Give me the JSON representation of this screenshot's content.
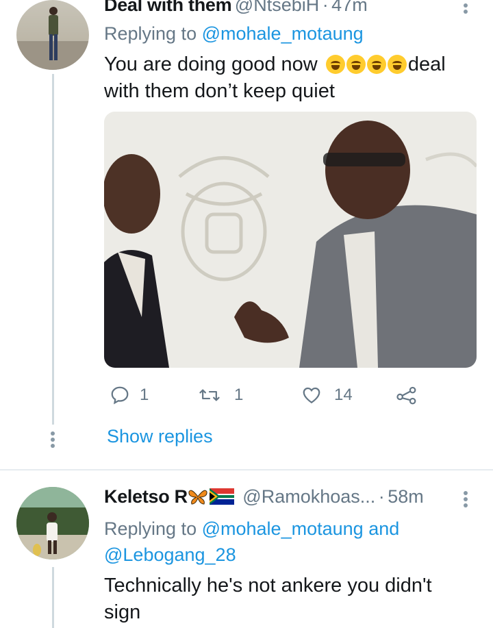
{
  "tweet1": {
    "display_name": "Deal with them",
    "handle": "@NtsebiH",
    "separator": "·",
    "time": "47m",
    "replying_prefix": "Replying to",
    "replying_to": "@mohale_motaung",
    "text_part1": "You are doing good now",
    "text_part2": "deal",
    "text_line2": "with them don’t keep quiet",
    "emoji_count": 4,
    "actions": {
      "replies": "1",
      "retweets": "1",
      "likes": "14"
    },
    "show_replies": "Show replies"
  },
  "tweet2": {
    "display_name": "Keletso R",
    "handle": "@Ramokhoas...",
    "separator": "·",
    "time": "58m",
    "replying_prefix": "Replying to",
    "replying_to_1": "@mohale_motaung",
    "replying_and": "and",
    "replying_to_2": "@Lebogang_28",
    "text_line1": "Technically he's not ankere you didn't",
    "text_line2": "sign"
  },
  "colors": {
    "link": "#1b95e0",
    "muted": "#657786",
    "thread_line": "#cfd9de",
    "divider": "#e6ecf0"
  }
}
